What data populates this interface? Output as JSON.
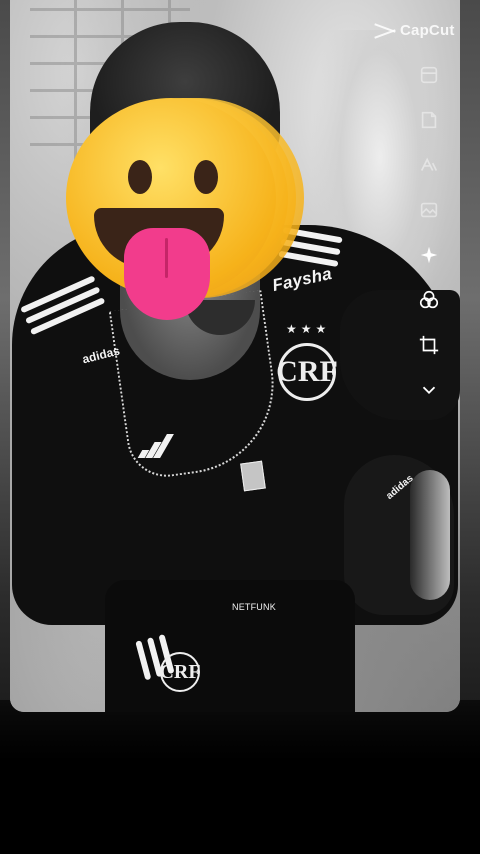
{
  "app": {
    "watermark_icon": "capcut-logo-icon",
    "watermark": "CapCut"
  },
  "photo": {
    "filter": "black-and-white",
    "face_sticker": "zany-face-emoji-icon",
    "jersey_sponsor": "Faysha",
    "jersey_brand": "adidas",
    "shorts_text": "NETFUNK",
    "crest_letters": "CRF"
  },
  "toolbar": {
    "items": [
      {
        "name": "templates-icon"
      },
      {
        "name": "sticker-icon"
      },
      {
        "name": "text-icon"
      },
      {
        "name": "image-edit-icon"
      },
      {
        "name": "effects-sparkle-icon"
      },
      {
        "name": "filters-icon"
      },
      {
        "name": "crop-icon"
      },
      {
        "name": "chevron-down-icon"
      }
    ]
  },
  "colors": {
    "emoji_yellow": "#f6b21a",
    "tongue_pink": "#f23c8c",
    "toolbar_icon": "#ffffff"
  }
}
